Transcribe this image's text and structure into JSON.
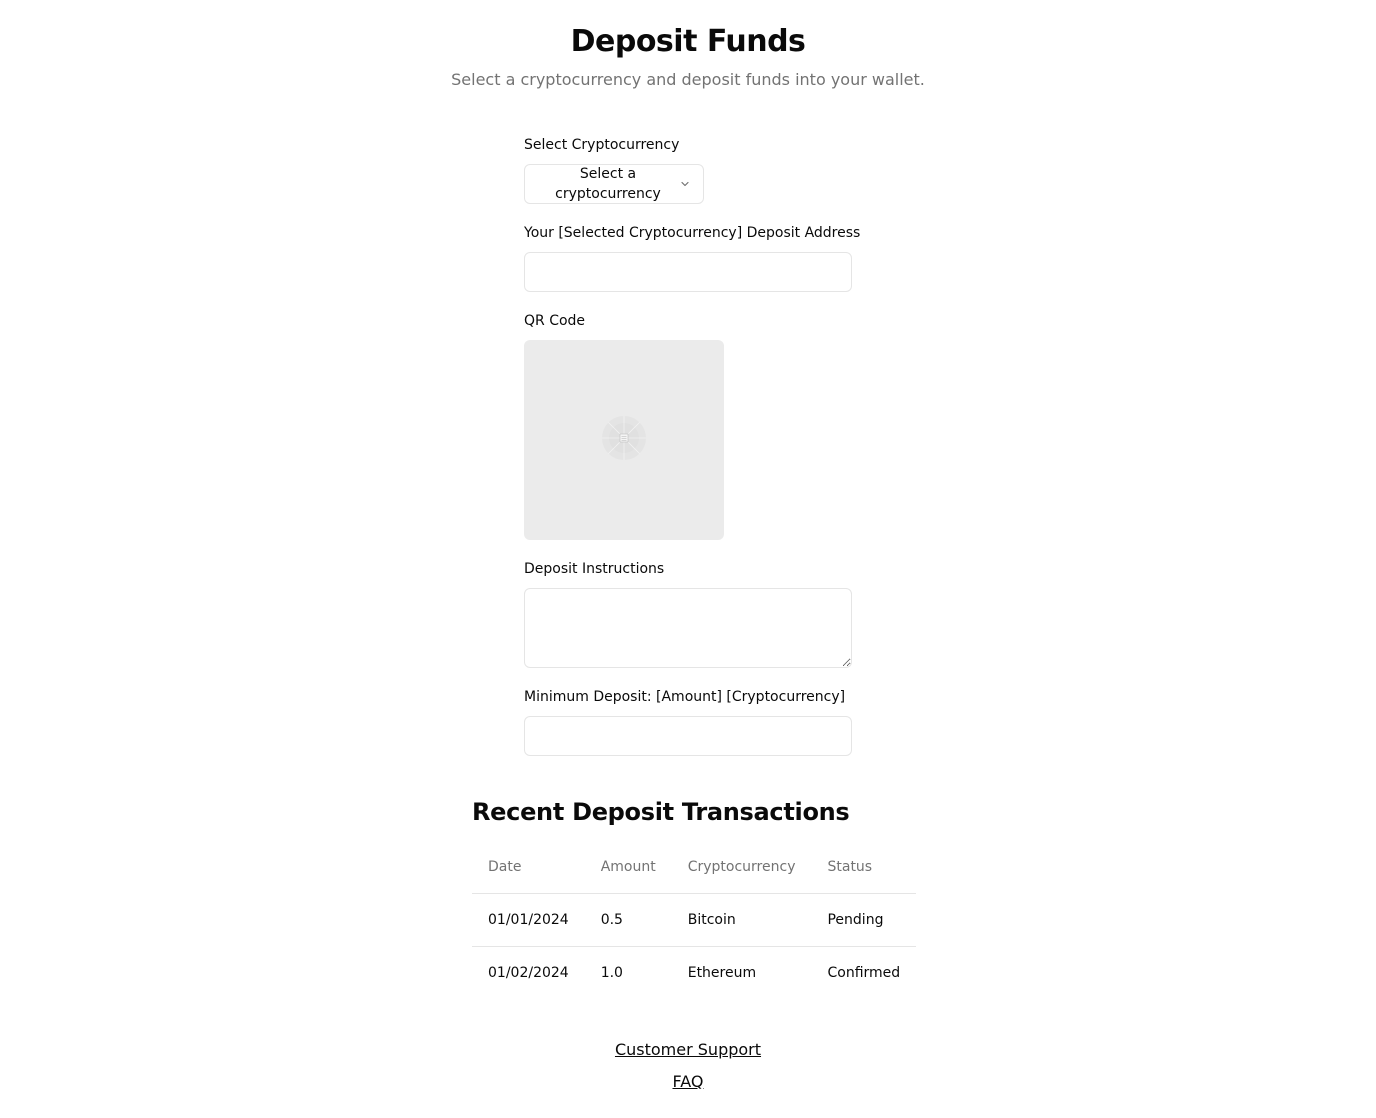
{
  "header": {
    "title": "Deposit Funds",
    "subtitle": "Select a cryptocurrency and deposit funds into your wallet."
  },
  "form": {
    "crypto_label": "Select Cryptocurrency",
    "crypto_select_value": "Select a cryptocurrency",
    "address_label": "Your [Selected Cryptocurrency] Deposit Address",
    "address_value": "",
    "qr_label": "QR Code",
    "instructions_label": "Deposit Instructions",
    "instructions_value": "",
    "minimum_label": "Minimum Deposit: [Amount] [Cryptocurrency]",
    "minimum_value": ""
  },
  "transactions": {
    "title": "Recent Deposit Transactions",
    "headers": [
      "Date",
      "Amount",
      "Cryptocurrency",
      "Status"
    ],
    "rows": [
      [
        "01/01/2024",
        "0.5",
        "Bitcoin",
        "Pending"
      ],
      [
        "01/02/2024",
        "1.0",
        "Ethereum",
        "Confirmed"
      ]
    ]
  },
  "footer": {
    "support_link": "Customer Support",
    "faq_link": "FAQ"
  },
  "icons": {
    "select_chevron": "chevron-down-icon",
    "qr_placeholder": "qr-code-icon"
  },
  "colors": {
    "text": "#0a0a0a",
    "muted": "#737373",
    "border": "#e5e5e5",
    "qr_bg": "#ebebeb"
  }
}
